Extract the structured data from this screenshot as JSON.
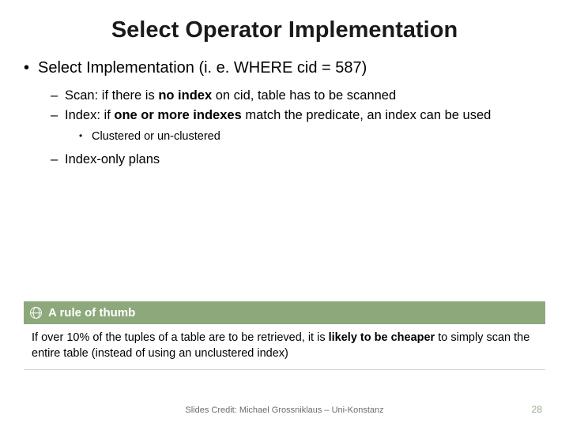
{
  "title": "Select Operator Implementation",
  "bullets": {
    "b1": "Select Implementation (i. e. WHERE cid = 587)",
    "scan_pre": "Scan: if there is ",
    "scan_bold": "no index",
    "scan_post": " on cid, table has to be scanned",
    "index_pre": "Index: if ",
    "index_bold": "one or more indexes",
    "index_post": " match the predicate, an index can be used",
    "clustered": "Clustered or un-clustered",
    "indexonly": "Index-only plans"
  },
  "callout": {
    "heading": "A rule of thumb",
    "body_pre": "If over 10% of the tuples of a table are to be retrieved, it is ",
    "body_bold": "likely to be cheaper",
    "body_post": " to simply scan the entire table (instead of using an unclustered index)"
  },
  "footer": {
    "credit": "Slides Credit: Michael Grossniklaus – Uni-Konstanz",
    "page": "28"
  }
}
